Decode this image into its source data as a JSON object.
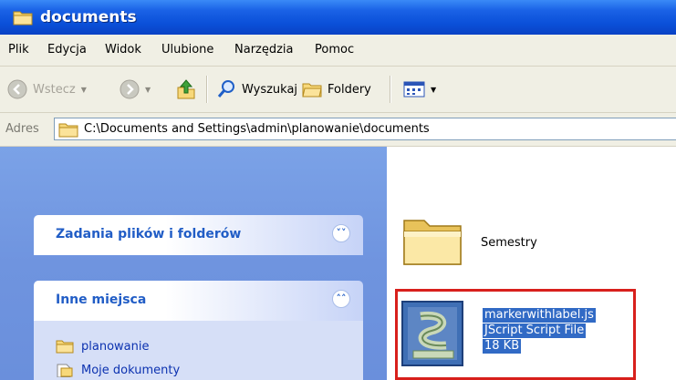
{
  "window": {
    "title": "documents"
  },
  "menu": [
    "Plik",
    "Edycja",
    "Widok",
    "Ulubione",
    "Narzędzia",
    "Pomoc"
  ],
  "toolbar": {
    "back_label": "Wstecz",
    "search_label": "Wyszukaj",
    "folders_label": "Foldery"
  },
  "address": {
    "label": "Adres",
    "path": "C:\\Documents and Settings\\admin\\planowanie\\documents"
  },
  "tasks": {
    "file_tasks_title": "Zadania plików i folderów",
    "other_places_title": "Inne miejsca",
    "places": [
      "planowanie",
      "Moje dokumenty"
    ]
  },
  "files": [
    {
      "name": "Semestry"
    },
    {
      "name": "markerwithlabel.js",
      "type": "JScript Script File",
      "size": "18 KB",
      "selected": true
    }
  ],
  "colors": {
    "titlebar": "#0a4fd8",
    "taskpane": "#6f94df",
    "selection": "#316ac5",
    "highlight_box": "#d8201c"
  }
}
